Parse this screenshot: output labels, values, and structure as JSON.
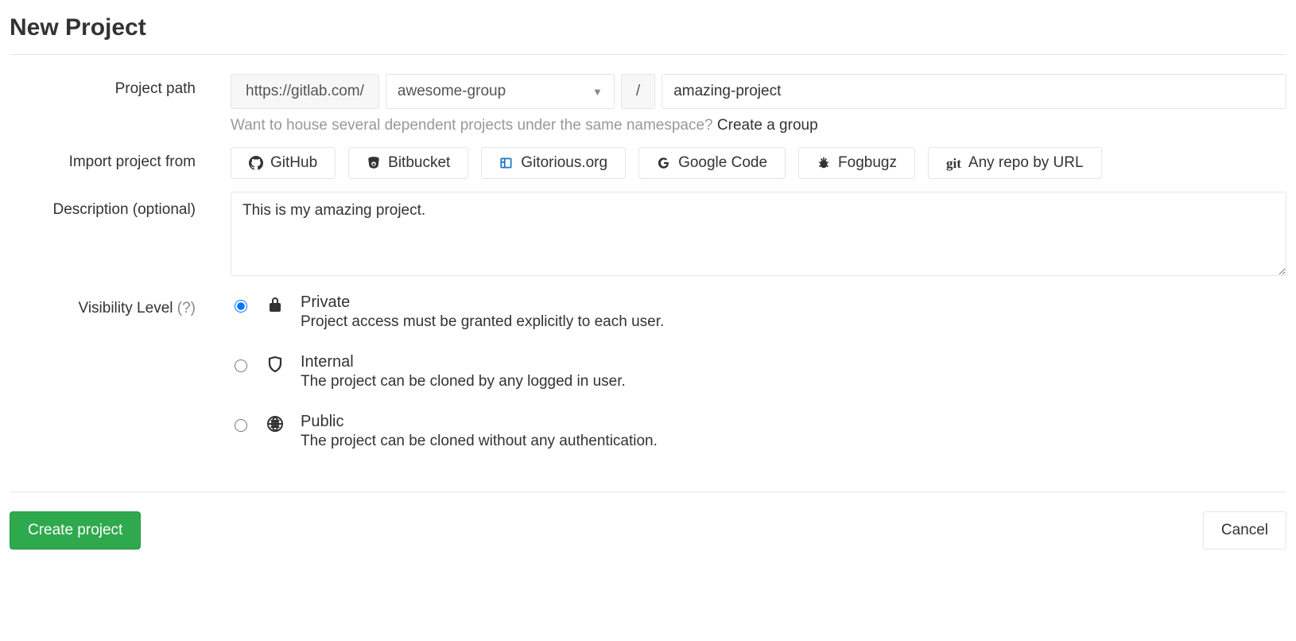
{
  "page": {
    "title": "New Project"
  },
  "labels": {
    "project_path": "Project path",
    "import_from": "Import project from",
    "description": "Description (optional)",
    "visibility": "Visibility Level ",
    "visibility_help": "(?)"
  },
  "path": {
    "host": "https://gitlab.com/",
    "namespace": "awesome-group",
    "separator": "/",
    "slug": "amazing-project"
  },
  "hint": {
    "text": "Want to house several dependent projects under the same namespace? ",
    "link": "Create a group"
  },
  "imports": {
    "github": "GitHub",
    "bitbucket": "Bitbucket",
    "gitorious": "Gitorious.org",
    "googlecode": "Google Code",
    "fogbugz": "Fogbugz",
    "anyrepo": "Any repo by URL",
    "git_prefix": "git"
  },
  "description_value": "This is my amazing project.",
  "visibility": {
    "private": {
      "title": "Private",
      "desc": "Project access must be granted explicitly to each user."
    },
    "internal": {
      "title": "Internal",
      "desc": "The project can be cloned by any logged in user."
    },
    "public": {
      "title": "Public",
      "desc": "The project can be cloned without any authentication."
    },
    "selected": "private"
  },
  "buttons": {
    "create": "Create project",
    "cancel": "Cancel"
  }
}
